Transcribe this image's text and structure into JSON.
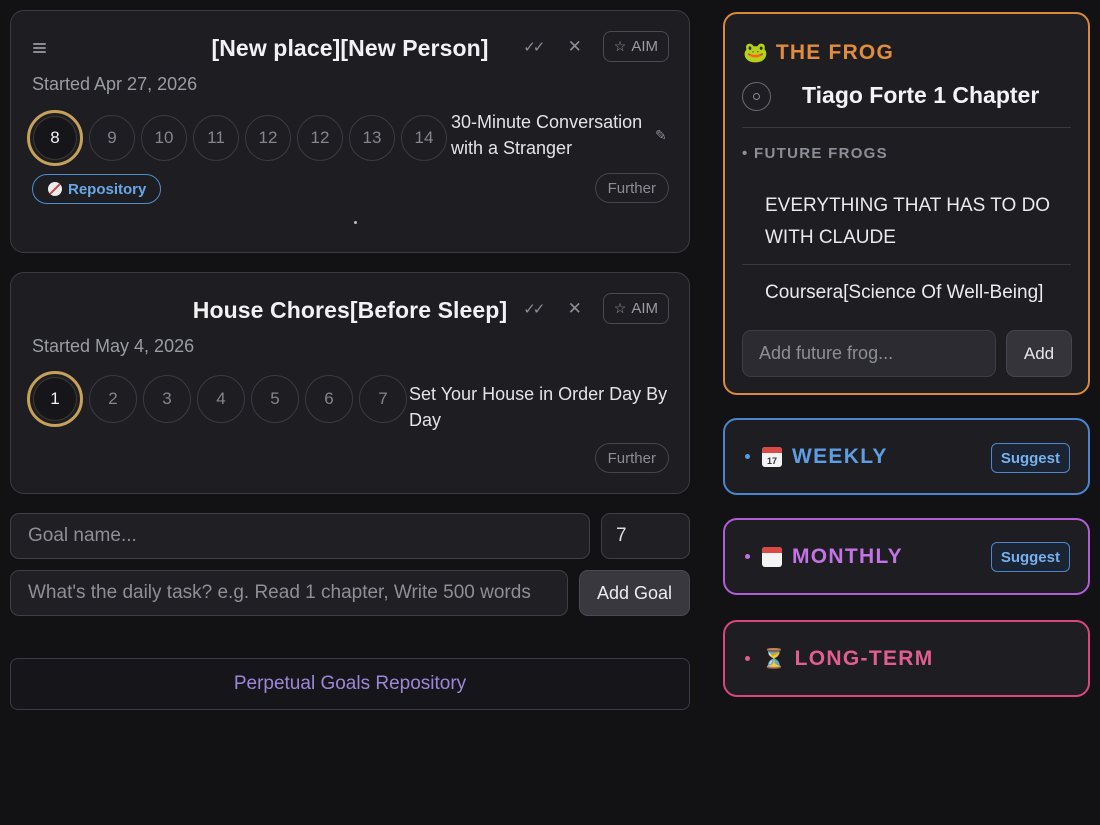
{
  "goals": [
    {
      "title": "[New place][New Person]",
      "started": "Started Apr 27, 2026",
      "days": [
        "8",
        "9",
        "10",
        "11",
        "12",
        "12",
        "13",
        "14"
      ],
      "current_day": "8",
      "task": "30-Minute Conversation with a Stranger",
      "badge": "Repository",
      "further": "Further",
      "aim": "AIM",
      "check_icon": "double-check-icon",
      "close_icon": "close-icon"
    },
    {
      "title": "House Chores[Before Sleep]",
      "started": "Started May 4, 2026",
      "days": [
        "1",
        "2",
        "3",
        "4",
        "5",
        "6",
        "7"
      ],
      "current_day": "1",
      "task": "Set Your House in Order Day By Day",
      "further": "Further",
      "aim": "AIM"
    }
  ],
  "form": {
    "goal_name_placeholder": "Goal name...",
    "days_value": "7",
    "task_placeholder": "What's the daily task? e.g. Read 1 chapter, Write 500 words",
    "add_goal_label": "Add Goal"
  },
  "repository_link": "Perpetual Goals Repository",
  "frog": {
    "emoji": "🐸",
    "title": "THE FROG",
    "current": "Tiago Forte 1 Chapter",
    "future_label": "• FUTURE FROGS",
    "future_items": [
      "EVERYTHING THAT HAS TO DO WITH CLAUDE",
      "Coursera[Science Of Well-Being]"
    ],
    "input_placeholder": "Add future frog...",
    "add_label": "Add"
  },
  "horizons": {
    "weekly": {
      "title": "WEEKLY",
      "icon_text": "17",
      "suggest": "Suggest"
    },
    "monthly": {
      "title": "MONTHLY",
      "icon_text": "",
      "suggest": "Suggest"
    },
    "longterm": {
      "title": "LONG-TERM",
      "icon": "⏳"
    }
  },
  "colors": {
    "background": "#121215",
    "frog_accent": "#e38c3c",
    "weekly_accent": "#5f9de3",
    "monthly_accent": "#c472e6",
    "longterm_accent": "#e25e91",
    "current_day_ring": "#c5a15a",
    "repository_link": "#9d86d8"
  }
}
